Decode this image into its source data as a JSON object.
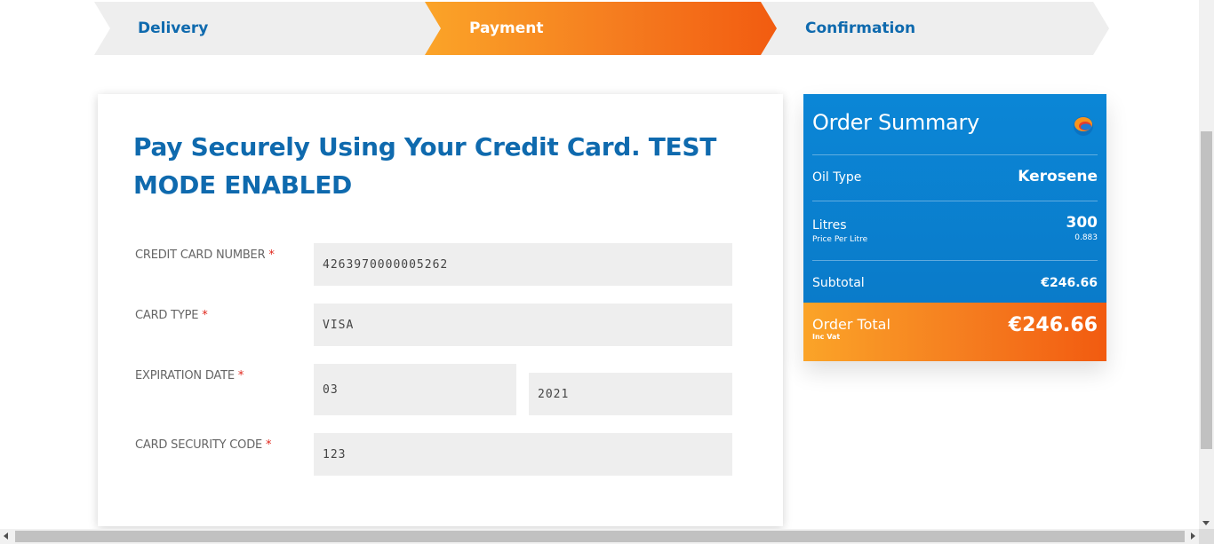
{
  "steps": {
    "delivery": "Delivery",
    "payment": "Payment",
    "confirmation": "Confirmation",
    "active": "Payment"
  },
  "payment_form": {
    "title": "Pay Securely Using Your Credit Card. TEST MODE ENABLED",
    "required_marker": "*",
    "card_number": {
      "label": "CREDIT CARD NUMBER",
      "value": "4263970000005262"
    },
    "card_type": {
      "label": "CARD TYPE",
      "value": "VISA"
    },
    "expiration": {
      "label": "EXPIRATION DATE",
      "month": "03",
      "year": "2021"
    },
    "security_code": {
      "label": "CARD SECURITY CODE",
      "value": "123"
    }
  },
  "order_summary": {
    "title": "Order Summary",
    "logo_icon": "brand-logo-icon",
    "oil_type": {
      "label": "Oil Type",
      "value": "Kerosene"
    },
    "litres": {
      "label": "Litres",
      "value": "300",
      "sub_label": "Price Per Litre",
      "sub_value": "0.883"
    },
    "subtotal": {
      "label": "Subtotal",
      "value": "€246.66"
    },
    "total": {
      "label": "Order Total",
      "sub_label": "Inc Vat",
      "value": "€246.66"
    }
  },
  "colors": {
    "brand_blue": "#0f6aae",
    "summary_blue": "#0a7fcf",
    "accent_orange_start": "#fba428",
    "accent_orange_end": "#f25b10",
    "required_red": "#e0261b",
    "input_bg": "#eeeeee"
  }
}
